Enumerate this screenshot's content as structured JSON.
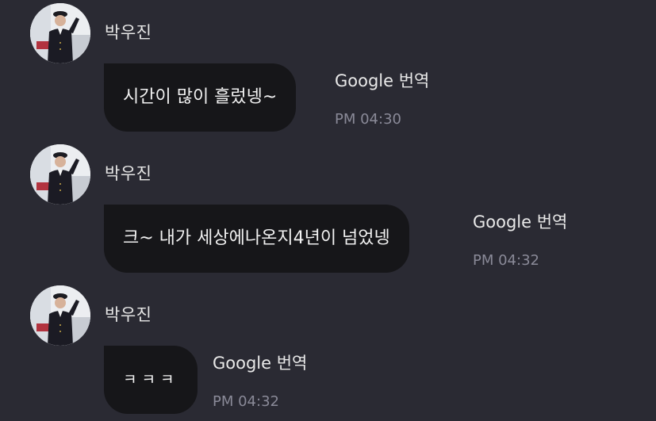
{
  "messages": [
    {
      "sender": "박우진",
      "text": "시간이 많이 흘렀넹~",
      "translate_label": "Google 번역",
      "time": "PM 04:30",
      "avatar_icon": "profile-photo-avatar"
    },
    {
      "sender": "박우진",
      "text": "크~ 내가 세상에나온지4년이 넘었넹",
      "translate_label": "Google 번역",
      "time": "PM 04:32",
      "avatar_icon": "profile-photo-avatar"
    },
    {
      "sender": "박우진",
      "text": "ㅋㅋㅋ",
      "translate_label": "Google 번역",
      "time": "PM 04:32",
      "avatar_icon": "profile-photo-avatar"
    }
  ],
  "colors": {
    "background": "#2a2a33",
    "bubble": "#161619",
    "text": "#f2f2f2",
    "time": "#8a8a98"
  }
}
